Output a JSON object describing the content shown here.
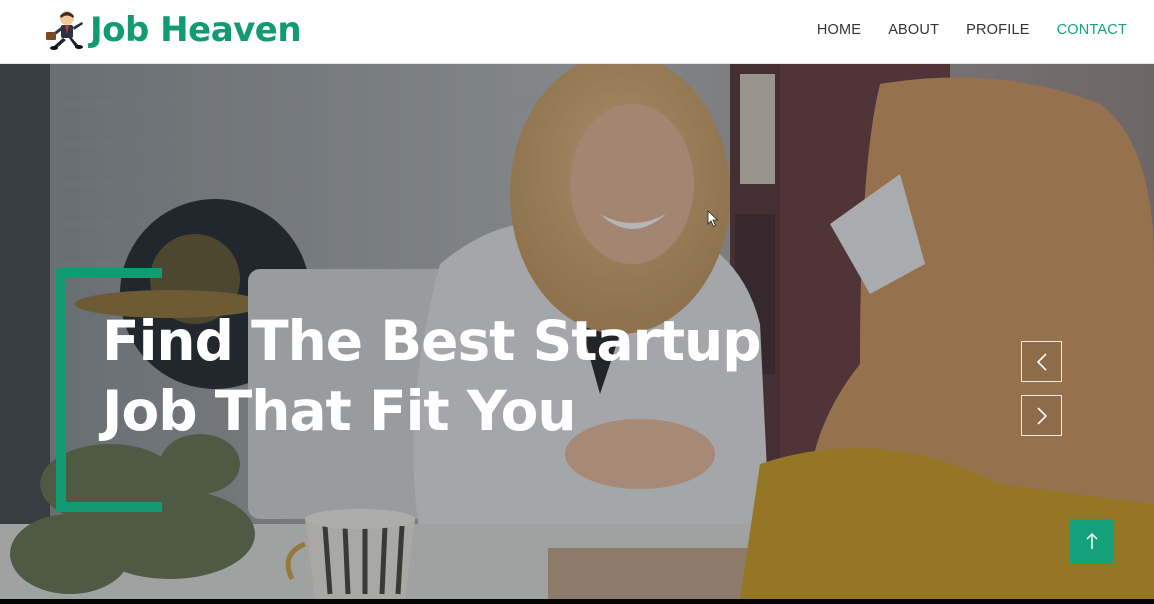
{
  "brand": {
    "name": "Job Heaven",
    "logo_icon": "runner-businessman-icon"
  },
  "nav": {
    "items": [
      {
        "label": "HOME",
        "active": false
      },
      {
        "label": "ABOUT",
        "active": false
      },
      {
        "label": "PROFILE",
        "active": false
      },
      {
        "label": "CONTACT",
        "active": true
      }
    ]
  },
  "hero": {
    "headline_line1": "Find The Best Startup",
    "headline_line2": "Job That Fit You",
    "prev_icon": "chevron-left-icon",
    "next_icon": "chevron-right-icon",
    "scroll_top_icon": "arrow-up-icon"
  },
  "colors": {
    "accent": "#129a72",
    "nav_active": "#17a283",
    "scroll_top_bg": "#13a07a"
  }
}
